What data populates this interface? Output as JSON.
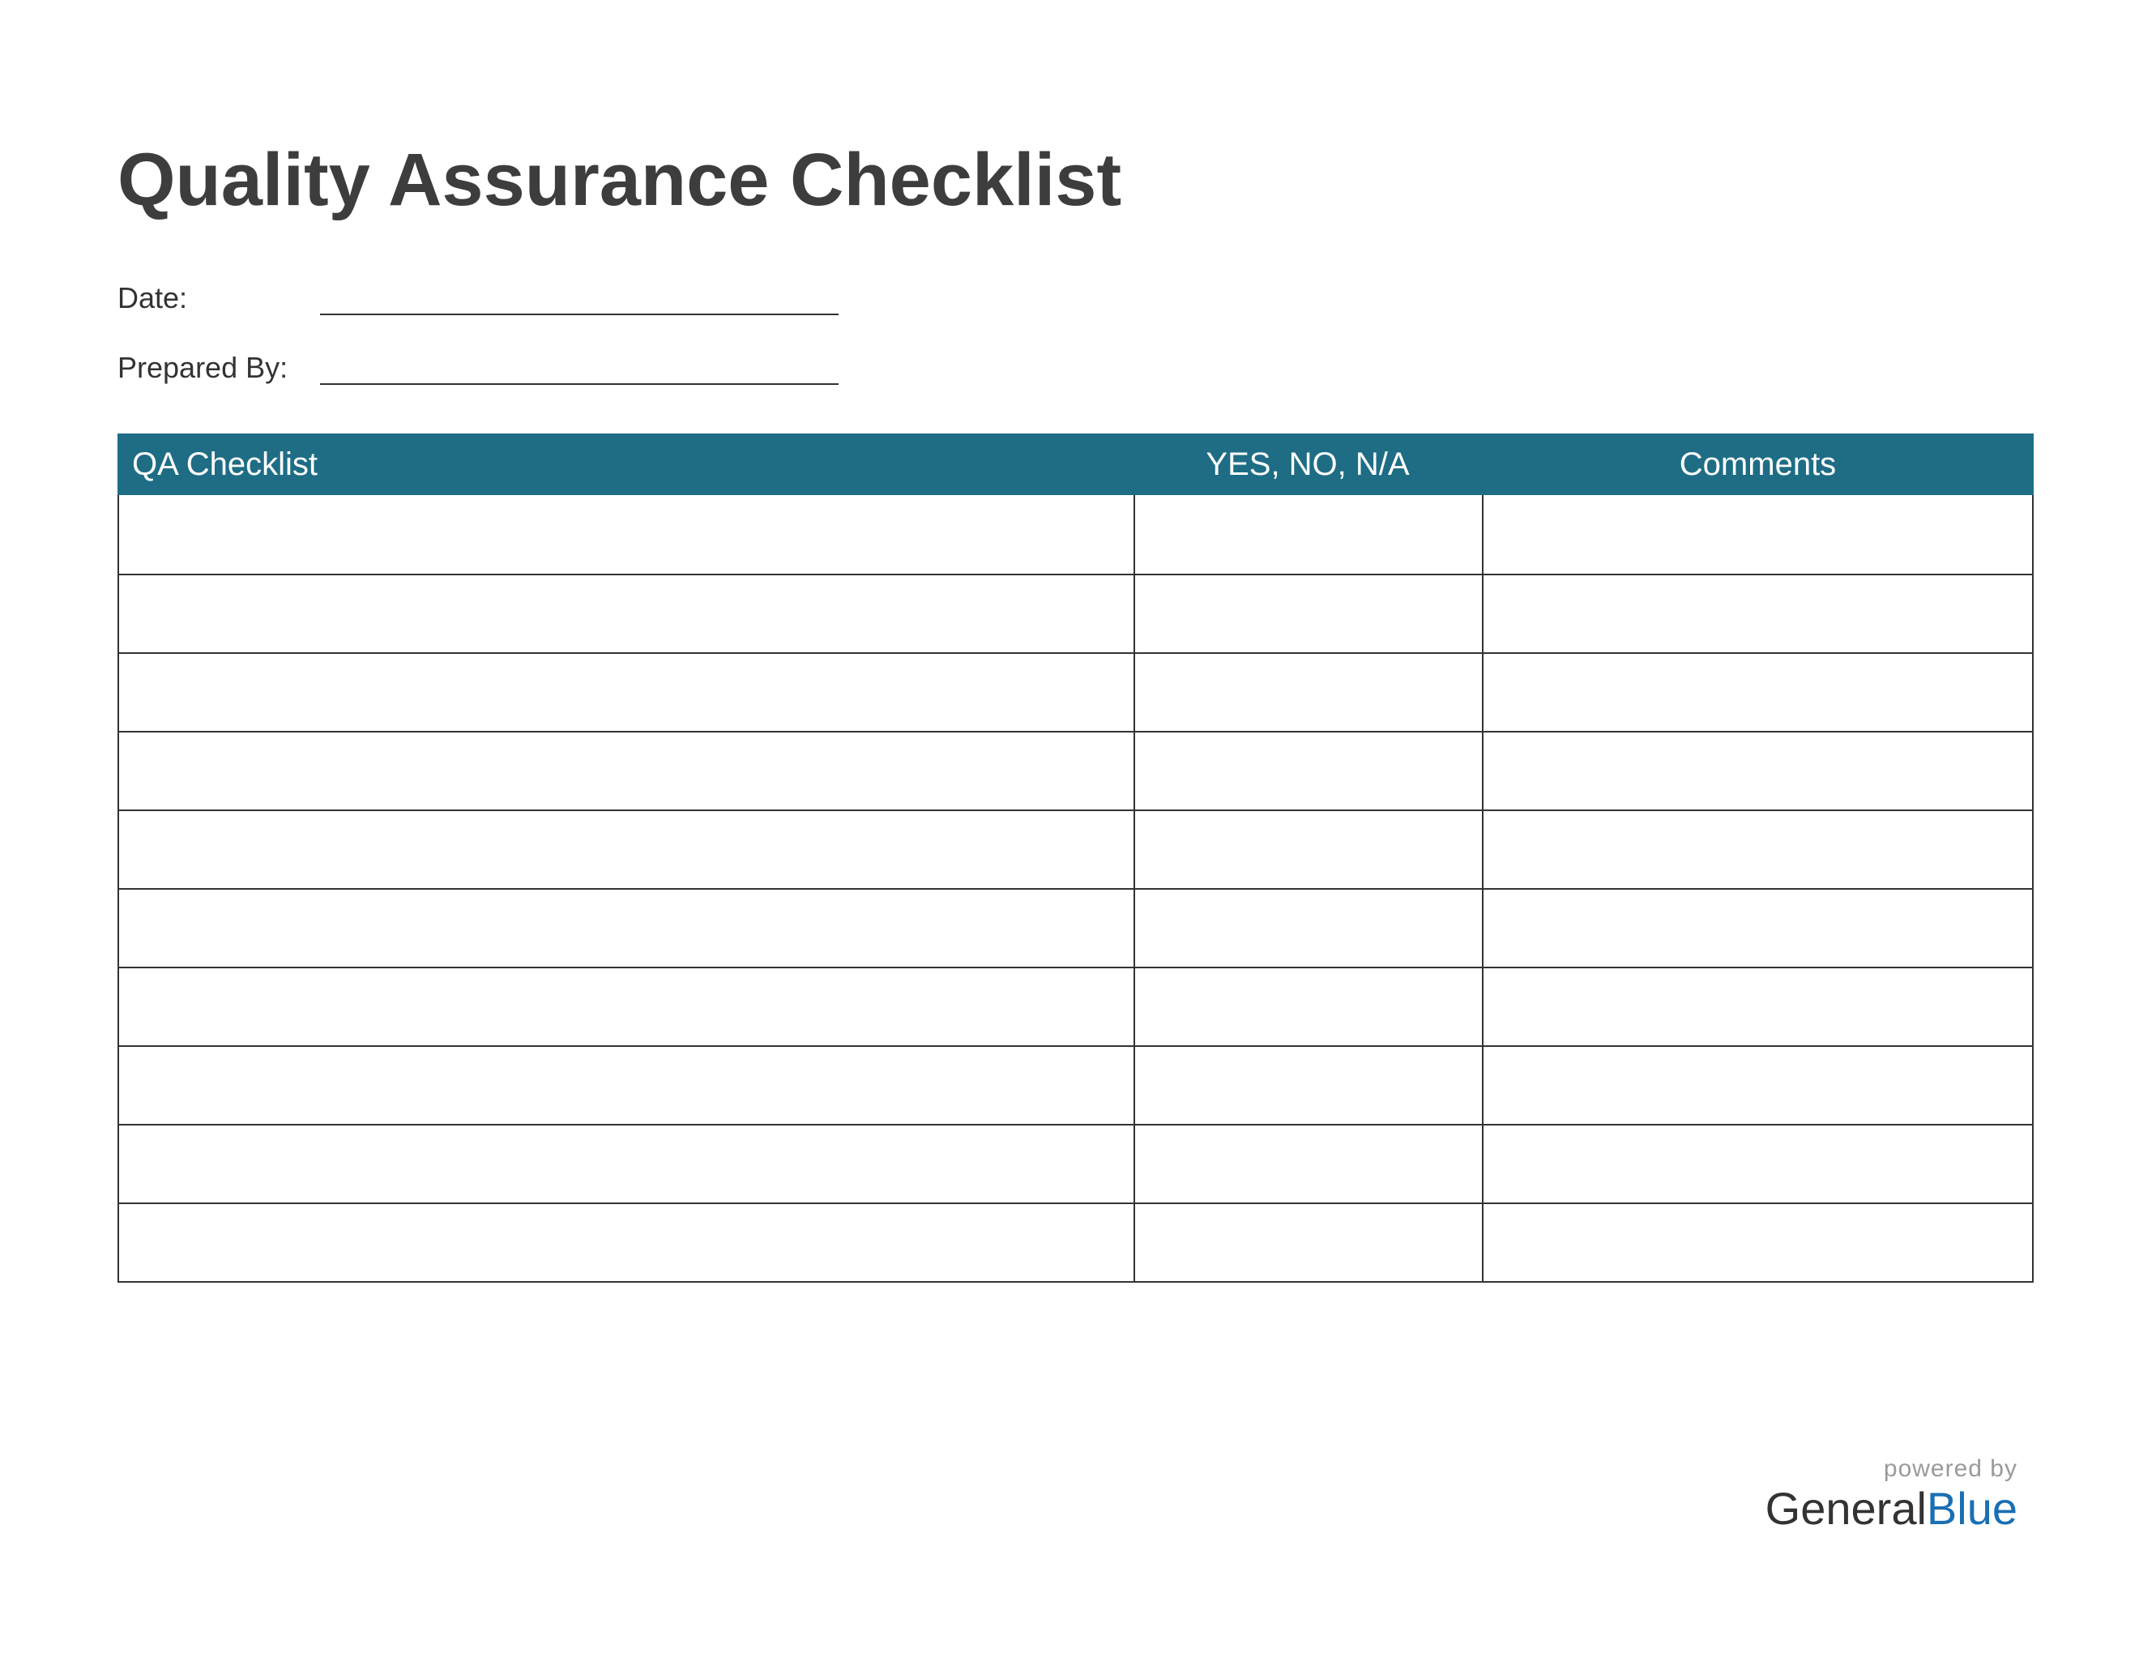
{
  "title": "Quality Assurance Checklist",
  "meta": {
    "date_label": "Date:",
    "date_value": "",
    "prepared_by_label": "Prepared By:",
    "prepared_by_value": ""
  },
  "table": {
    "headers": {
      "col1": "QA Checklist",
      "col2": "YES, NO, N/A",
      "col3": "Comments"
    },
    "rows": [
      {
        "item": "",
        "status": "",
        "comments": ""
      },
      {
        "item": "",
        "status": "",
        "comments": ""
      },
      {
        "item": "",
        "status": "",
        "comments": ""
      },
      {
        "item": "",
        "status": "",
        "comments": ""
      },
      {
        "item": "",
        "status": "",
        "comments": ""
      },
      {
        "item": "",
        "status": "",
        "comments": ""
      },
      {
        "item": "",
        "status": "",
        "comments": ""
      },
      {
        "item": "",
        "status": "",
        "comments": ""
      },
      {
        "item": "",
        "status": "",
        "comments": ""
      },
      {
        "item": "",
        "status": "",
        "comments": ""
      }
    ]
  },
  "footer": {
    "powered_by": "powered by",
    "brand_part1": "General",
    "brand_part2": "Blue"
  },
  "colors": {
    "header_teal": "#1e6d85",
    "brand_blue": "#1a6fb3",
    "text_dark": "#333333"
  }
}
